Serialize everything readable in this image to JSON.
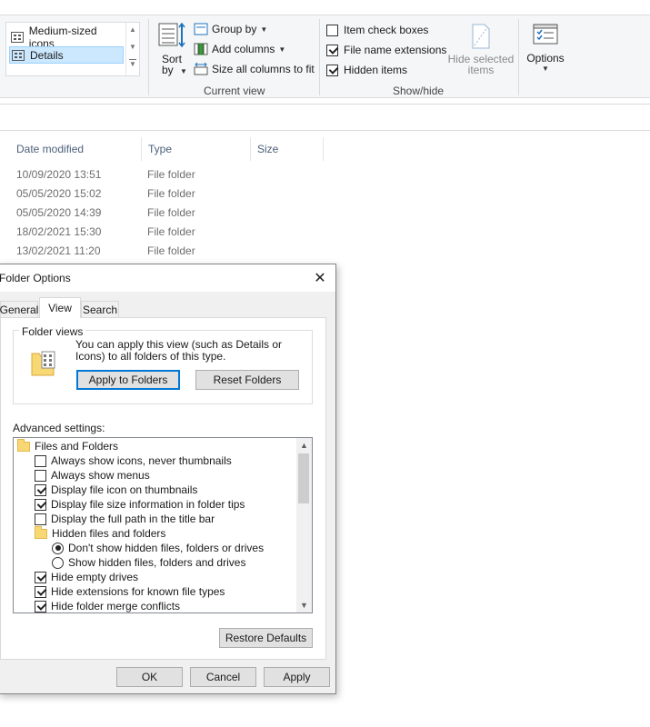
{
  "ribbon": {
    "layout_items": [
      {
        "label": "Medium-sized icons",
        "icon": "medium-icons-icon",
        "selected": false
      },
      {
        "label": "Details",
        "icon": "details-icon",
        "selected": true
      }
    ],
    "current_view": {
      "group_label": "Current view",
      "sort_by": "Sort by",
      "group_by": "Group by",
      "add_columns": "Add columns",
      "size_all_columns": "Size all columns to fit"
    },
    "show_hide": {
      "group_label": "Show/hide",
      "item_check_boxes": {
        "label": "Item check boxes",
        "checked": false
      },
      "file_name_extensions": {
        "label": "File name extensions",
        "checked": true
      },
      "hidden_items": {
        "label": "Hidden items",
        "checked": true
      },
      "hide_selected_items": "Hide selected items"
    },
    "options": "Options"
  },
  "file_list": {
    "columns": [
      "Date modified",
      "Type",
      "Size"
    ],
    "rows": [
      {
        "date": "10/09/2020 13:51",
        "type": "File folder",
        "size": ""
      },
      {
        "date": "05/05/2020 15:02",
        "type": "File folder",
        "size": ""
      },
      {
        "date": "05/05/2020 14:39",
        "type": "File folder",
        "size": ""
      },
      {
        "date": "18/02/2021 15:30",
        "type": "File folder",
        "size": ""
      },
      {
        "date": "13/02/2021 11:20",
        "type": "File folder",
        "size": ""
      }
    ]
  },
  "dialog": {
    "title": "Folder Options",
    "tabs": [
      "General",
      "View",
      "Search"
    ],
    "active_tab": "View",
    "folder_views": {
      "label": "Folder views",
      "description": "You can apply this view (such as Details or Icons) to all folders of this type.",
      "apply_button": "Apply to Folders",
      "reset_button": "Reset Folders"
    },
    "advanced_label": "Advanced settings:",
    "advanced_items": [
      {
        "kind": "folder",
        "label": "Files and Folders",
        "level": 0
      },
      {
        "kind": "checkbox",
        "label": "Always show icons, never thumbnails",
        "checked": false,
        "level": 1
      },
      {
        "kind": "checkbox",
        "label": "Always show menus",
        "checked": false,
        "level": 1
      },
      {
        "kind": "checkbox",
        "label": "Display file icon on thumbnails",
        "checked": true,
        "level": 1
      },
      {
        "kind": "checkbox",
        "label": "Display file size information in folder tips",
        "checked": true,
        "level": 1
      },
      {
        "kind": "checkbox",
        "label": "Display the full path in the title bar",
        "checked": false,
        "level": 1
      },
      {
        "kind": "folder",
        "label": "Hidden files and folders",
        "level": 1
      },
      {
        "kind": "radio",
        "label": "Don't show hidden files, folders or drives",
        "checked": true,
        "level": 2
      },
      {
        "kind": "radio",
        "label": "Show hidden files, folders and drives",
        "checked": false,
        "level": 2
      },
      {
        "kind": "checkbox",
        "label": "Hide empty drives",
        "checked": true,
        "level": 1
      },
      {
        "kind": "checkbox",
        "label": "Hide extensions for known file types",
        "checked": true,
        "level": 1
      },
      {
        "kind": "checkbox",
        "label": "Hide folder merge conflicts",
        "checked": true,
        "level": 1
      }
    ],
    "restore_defaults": "Restore Defaults",
    "ok": "OK",
    "cancel": "Cancel",
    "apply": "Apply"
  }
}
